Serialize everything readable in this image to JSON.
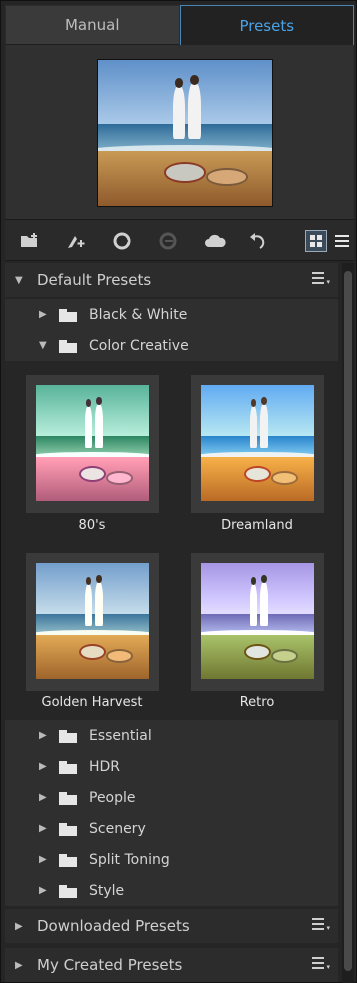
{
  "tabs": [
    {
      "label": "Manual",
      "active": false
    },
    {
      "label": "Presets",
      "active": true
    }
  ],
  "colors": {
    "accent": "#4aa3e6",
    "panel": "#252525",
    "row": "#2f2f2f"
  },
  "toolbar": {
    "icons": [
      "new-folder-icon",
      "new-preset-icon",
      "import-icon",
      "export-icon",
      "cloud-icon",
      "undo-icon"
    ],
    "view_modes": [
      "grid-view-icon",
      "list-view-icon"
    ]
  },
  "tree": {
    "default_presets": {
      "label": "Default Presets",
      "expanded": true,
      "folders": [
        {
          "label": "Black & White",
          "expanded": false
        },
        {
          "label": "Color Creative",
          "expanded": true
        }
      ],
      "presets": [
        {
          "name": "80's"
        },
        {
          "name": "Dreamland"
        },
        {
          "name": "Golden Harvest"
        },
        {
          "name": "Retro"
        }
      ],
      "more_folders": [
        {
          "label": "Essential"
        },
        {
          "label": "HDR"
        },
        {
          "label": "People"
        },
        {
          "label": "Scenery"
        },
        {
          "label": "Split Toning"
        },
        {
          "label": "Style"
        }
      ]
    },
    "downloaded_presets": {
      "label": "Downloaded Presets",
      "expanded": false
    },
    "my_created_presets": {
      "label": "My Created Presets",
      "expanded": false
    }
  }
}
